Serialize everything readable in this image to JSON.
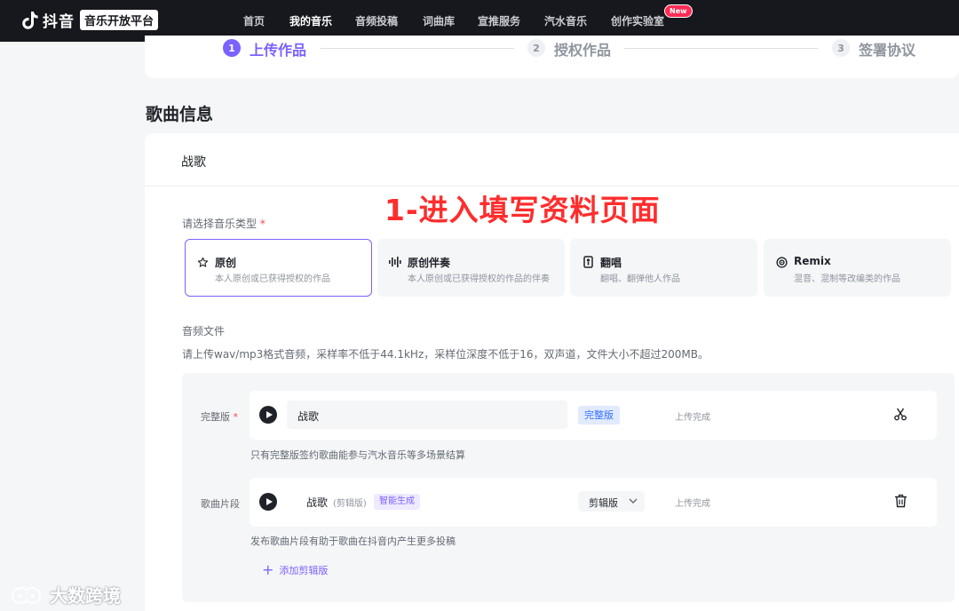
{
  "nav": {
    "logo_text": "抖音",
    "logo_badge": "音乐开放平台",
    "items": [
      "首页",
      "我的音乐",
      "音频投稿",
      "词曲库",
      "宣推服务",
      "汽水音乐",
      "创作实验室"
    ],
    "new_badge": "New"
  },
  "steps": [
    {
      "num": "1",
      "label": "上传作品"
    },
    {
      "num": "2",
      "label": "授权作品"
    },
    {
      "num": "3",
      "label": "签署协议"
    }
  ],
  "section_title": "歌曲信息",
  "song_title": "战歌",
  "overlay_caption": "1-进入填写资料页面",
  "music_type": {
    "label": "请选择音乐类型",
    "required_mark": "*",
    "options": [
      {
        "icon": "star-icon",
        "name": "原创",
        "desc": "本人原创或已获得授权的作品",
        "selected": true
      },
      {
        "icon": "waveform-icon",
        "name": "原创伴奏",
        "desc": "本人原创或已获得授权的作品的伴奏",
        "selected": false
      },
      {
        "icon": "mic-icon",
        "name": "翻唱",
        "desc": "翻唱、翻弹他人作品",
        "selected": false
      },
      {
        "icon": "remix-icon",
        "name": "Remix",
        "desc": "混音、混制等改编类的作品",
        "selected": false
      }
    ]
  },
  "audio": {
    "label": "音频文件",
    "hint": "请上传wav/mp3格式音频，采样率不低于44.1kHz，采样位深度不低于16，双声道，文件大小不超过200MB。",
    "full": {
      "label": "完整版",
      "required_mark": "*",
      "name": "战歌",
      "tag": "完整版",
      "status": "上传完成",
      "hint": "只有完整版签约歌曲能参与汽水音乐等多场景结算"
    },
    "clip": {
      "label": "歌曲片段",
      "name": "战歌",
      "sub": "(剪辑版)",
      "tag": "智能生成",
      "select_value": "剪辑版",
      "status": "上传完成",
      "hint": "发布歌曲片段有助于歌曲在抖音内产生更多投稿"
    },
    "add_clip_label": "添加剪辑版"
  },
  "watermark": "大数跨境",
  "colors": {
    "accent": "#7b61ff",
    "nav_bg": "#16181d",
    "caption": "#ff2d2d",
    "tag_blue": "#3370ff"
  }
}
